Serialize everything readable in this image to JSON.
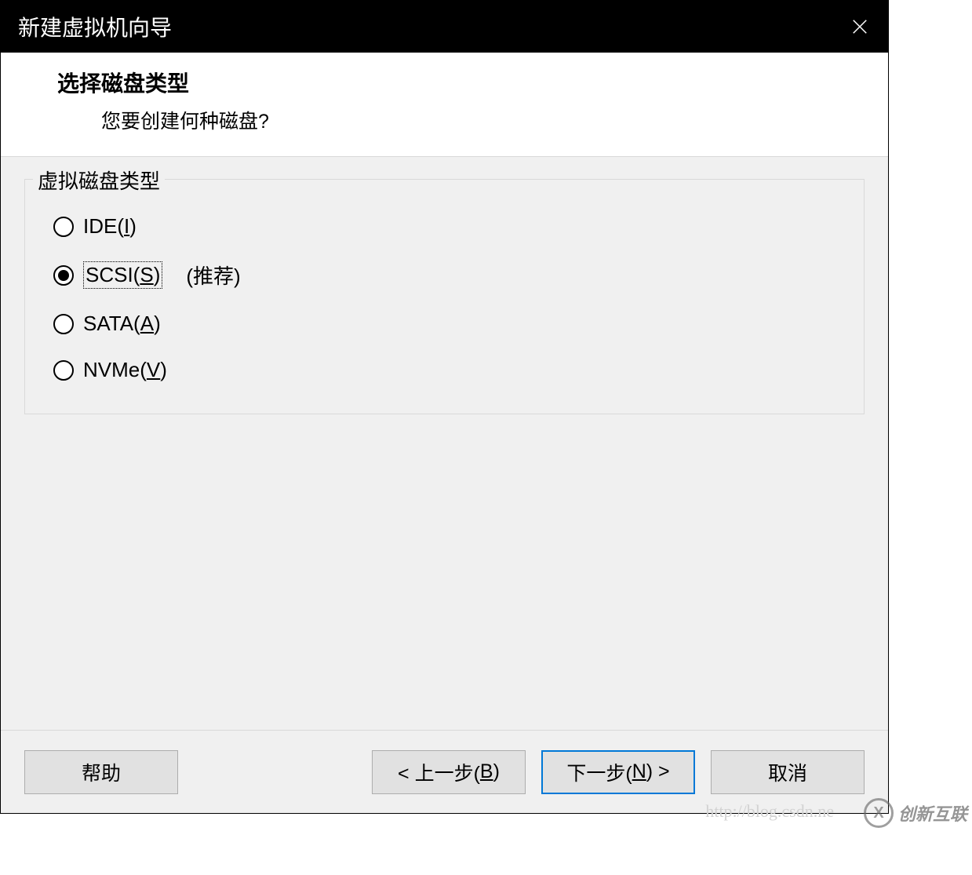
{
  "titlebar": {
    "title": "新建虚拟机向导"
  },
  "header": {
    "title": "选择磁盘类型",
    "subtitle": "您要创建何种磁盘?"
  },
  "diskTypeGroup": {
    "legend": "虚拟磁盘类型",
    "options": [
      {
        "prefix": "IDE(",
        "hotkey": "I",
        "suffix": ")",
        "note": "",
        "checked": false
      },
      {
        "prefix": "SCSI(",
        "hotkey": "S",
        "suffix": ")",
        "note": "(推荐)",
        "checked": true
      },
      {
        "prefix": "SATA(",
        "hotkey": "A",
        "suffix": ")",
        "note": "",
        "checked": false
      },
      {
        "prefix": "NVMe(",
        "hotkey": "V",
        "suffix": ")",
        "note": "",
        "checked": false
      }
    ]
  },
  "footer": {
    "help": "帮助",
    "back_pre": "< 上一步(",
    "back_key": "B",
    "back_post": ")",
    "next_pre": "下一步(",
    "next_key": "N",
    "next_post": ") >",
    "cancel": "取消"
  },
  "watermark": {
    "icon": "X",
    "label": "创新互联"
  },
  "ghost_url": "http://blog.csdn.ne"
}
